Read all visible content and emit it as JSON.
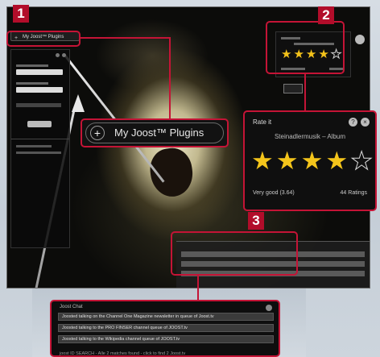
{
  "callouts": {
    "one": "1",
    "two": "2",
    "three": "3"
  },
  "plugins": {
    "label": "My Joost™ Plugins",
    "mini_label": "My Joost™ Plugins"
  },
  "rating": {
    "title": "Rate it",
    "subtitle": "Steinadlermusik – Album",
    "stars_filled": 4,
    "stars_total": 5,
    "score_text": "Very good (3.64)",
    "count_text": "44 Ratings"
  },
  "chat": {
    "title": "Joost Chat",
    "rows": [
      "Joosted talking on the Channel One Magazine newsletter in queue of Joost.tv",
      "Joosted talking to the PRO FINSER channel queue of JOOST.tv",
      "Joosted talking to the Wikipedia channel queue of JOOST.tv"
    ],
    "footer": "joost ID SEARCH - Alle 2 matches found - click to find 2 Joost.tv"
  },
  "colors": {
    "accent": "#c41436",
    "badge": "#b20d2a",
    "star": "#f4c51b"
  }
}
